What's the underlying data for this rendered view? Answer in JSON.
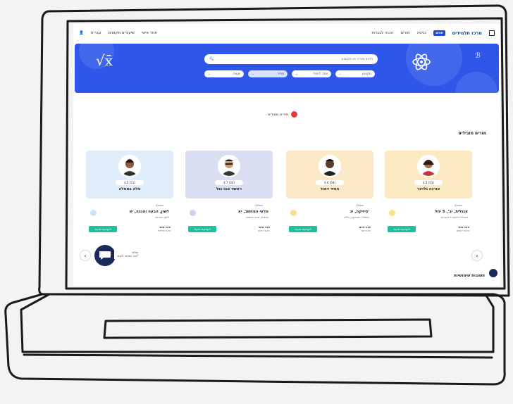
{
  "nav": {
    "left_items": [
      "עברית",
      "שיעורים מקוונים",
      "אזור אישי"
    ],
    "right_items": [
      "הכנה לבגרות",
      "מורים",
      "כניסה"
    ],
    "logo_text": "מרכז תלמידים"
  },
  "hero": {
    "search_placeholder": "חפש מורה או מקצוע",
    "filters": [
      "מקצוע",
      "שלב לימודי",
      "מחיר",
      "שעות"
    ]
  },
  "fav_link": "מורים שמורים",
  "section_title": "מורים מובילים",
  "cards": [
    {
      "name": "אורנה גלזינר",
      "rating": "4.5 (53)",
      "badge": "מומלץ",
      "subject": "אנגלית, יב', 5 יחל",
      "subtitle": "אנגלית מדוברת ובגרות",
      "cta": "לקביעת שיעור",
      "avail": "פנוי מחר",
      "avail_sub": "ביום ראשון"
    },
    {
      "name": "הסיד דאוד",
      "rating": "4.6 (58)",
      "badge": "מומלץ",
      "subject": "פיזיקה, יב'",
      "subtitle": "חשמל, מכניקה, גלים",
      "cta": "לקביעת שיעור",
      "avail": "פנוי היום",
      "avail_sub": "ביום שני"
    },
    {
      "name": "ראשד אבו גנל",
      "rating": "4.7 (32)",
      "badge": "מומלץ",
      "subject": "מדעי המחשב, יא",
      "subtitle": "תכנות, מבני נתונים",
      "cta": "לקביעת שיעור",
      "avail": "פנוי מחר",
      "avail_sub": "ביום רביעי"
    },
    {
      "name": "טלה במסלה",
      "rating": "4.5 (51)",
      "badge": "מומלץ",
      "subject": "לשון, הבעה והבנה, יא",
      "subtitle": "לשון ובגרות",
      "cta": "לקביעת שיעור",
      "avail": "פנוי מחר",
      "avail_sub": "ביום שלישי"
    }
  ],
  "chat": {
    "label": "צ'אט",
    "popup_title": "שלום",
    "popup_sub": "איך אפשר לעזור?"
  },
  "bottom_heading": "תשובות שימושיות"
}
